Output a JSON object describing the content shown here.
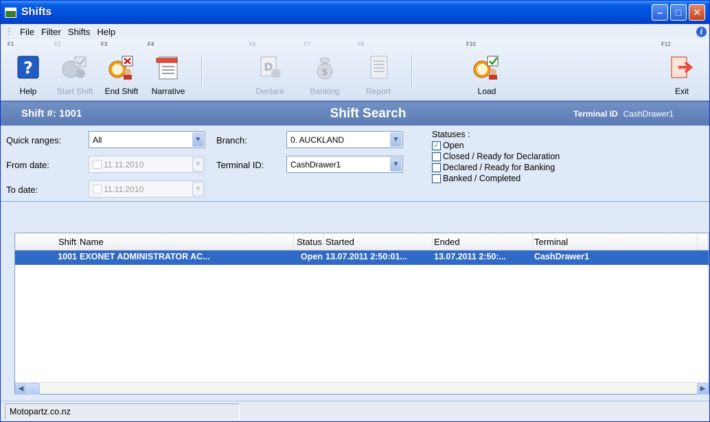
{
  "window": {
    "title": "Shifts"
  },
  "menu": [
    "File",
    "Filter",
    "Shifts",
    "Help"
  ],
  "toolbar": [
    {
      "key": "F1",
      "label": "Help",
      "icon": "help-icon",
      "enabled": true
    },
    {
      "key": "F2",
      "label": "Start Shift",
      "icon": "start-shift-icon",
      "enabled": false
    },
    {
      "key": "F3",
      "label": "End Shift",
      "icon": "end-shift-icon",
      "enabled": true
    },
    {
      "key": "F4",
      "label": "Narrative",
      "icon": "narrative-icon",
      "enabled": true
    },
    {
      "key": "F6",
      "label": "Declare",
      "icon": "declare-icon",
      "enabled": false
    },
    {
      "key": "F7",
      "label": "Banking",
      "icon": "banking-icon",
      "enabled": false
    },
    {
      "key": "F8",
      "label": "Report",
      "icon": "report-icon",
      "enabled": false
    },
    {
      "key": "F10",
      "label": "Load",
      "icon": "load-icon",
      "enabled": true
    },
    {
      "key": "F12",
      "label": "Exit",
      "icon": "exit-icon",
      "enabled": true
    }
  ],
  "header": {
    "shift_label": "Shift #: 1001",
    "title": "Shift Search",
    "terminal_label": "Terminal ID",
    "terminal_value": "CashDrawer1"
  },
  "filters": {
    "quick_ranges_label": "Quick ranges:",
    "quick_ranges_value": "All",
    "from_date_label": "From date:",
    "from_date_value": "11.11.2010",
    "to_date_label": "To date:",
    "to_date_value": "11.11.2010",
    "branch_label": "Branch:",
    "branch_value": "0. AUCKLAND",
    "terminal_label": "Terminal ID:",
    "terminal_value": "CashDrawer1",
    "statuses_label": "Statuses :",
    "statuses": [
      {
        "label": "Open",
        "checked": true
      },
      {
        "label": "Closed / Ready for Declaration",
        "checked": false
      },
      {
        "label": "Declared / Ready for Banking",
        "checked": false
      },
      {
        "label": "Banked / Completed",
        "checked": false
      }
    ]
  },
  "grid": {
    "columns": {
      "shift": "Shift",
      "name": "Name",
      "status": "Status",
      "started": "Started",
      "ended": "Ended",
      "terminal": "Terminal"
    },
    "rows": [
      {
        "shift": "1001",
        "name": "EXONET ADMINISTRATOR AC...",
        "status": "Open",
        "started": "13.07.2011 2:50:01...",
        "ended": "13.07.2011 2:50:...",
        "terminal": "CashDrawer1"
      }
    ]
  },
  "statusbar": {
    "text": "Motopartz.co.nz"
  },
  "colors": {
    "selection": "#3169c6",
    "header_strip": "#5a7ab3",
    "title_bar": "#0054e3"
  }
}
